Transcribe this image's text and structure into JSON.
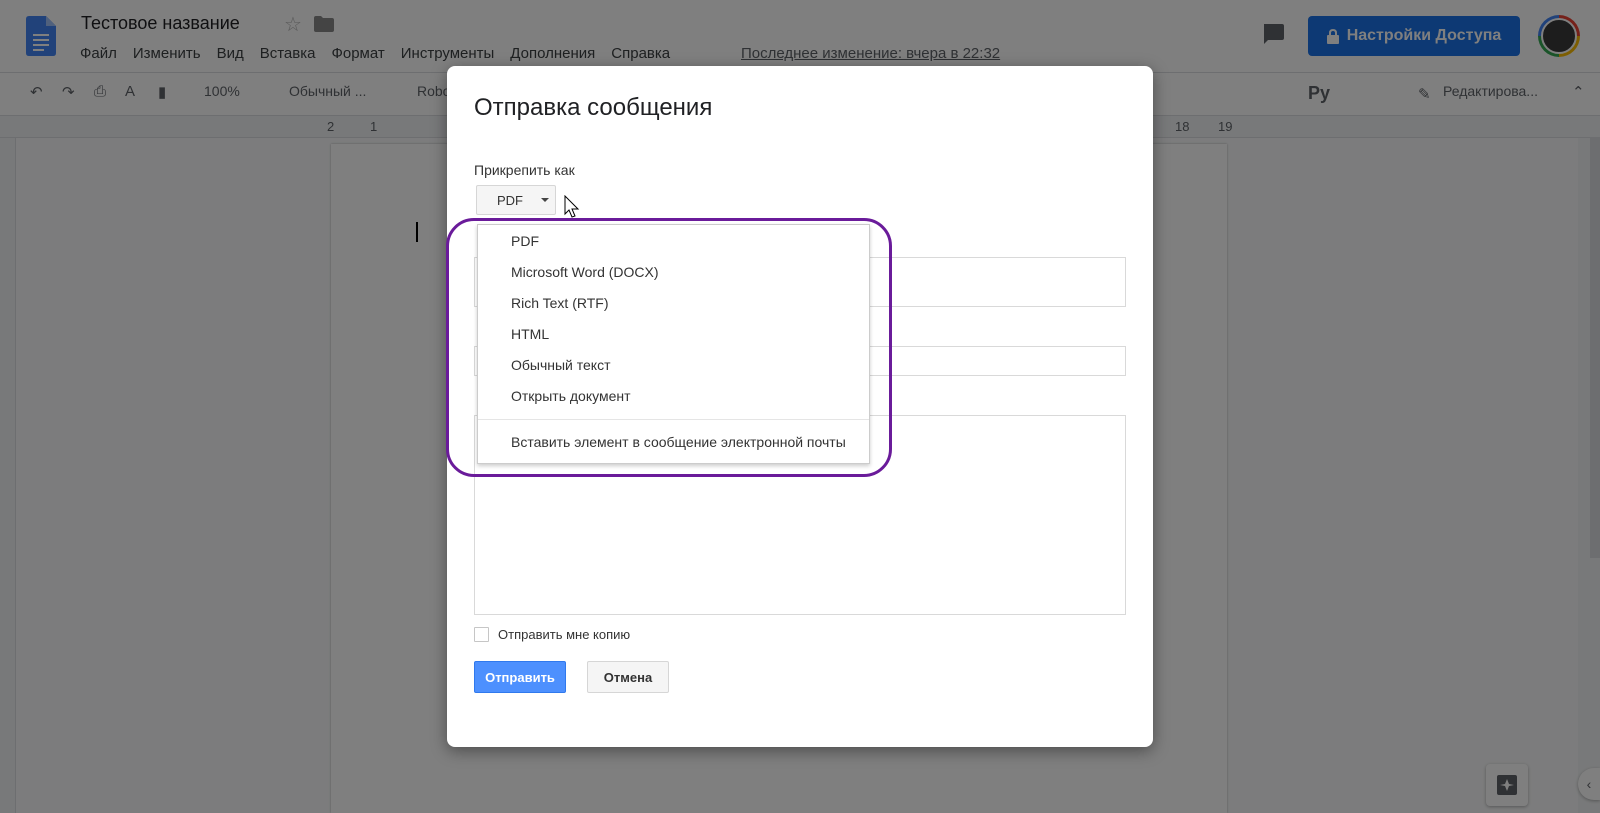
{
  "header": {
    "doc_title": "Тестовое название",
    "menu": [
      "Файл",
      "Изменить",
      "Вид",
      "Вставка",
      "Формат",
      "Инструменты",
      "Дополнения",
      "Справка"
    ],
    "last_edit": "Последнее изменение: вчера в 22:32",
    "share_label": "Настройки Доступа"
  },
  "toolbar": {
    "zoom": "100%",
    "style": "Обычный ...",
    "font": "Robo",
    "lang": "Ру",
    "mode": "Редактирова..."
  },
  "ruler": {
    "left_nums": [
      "2",
      "1"
    ],
    "right_nums": [
      "18",
      "19"
    ]
  },
  "dialog": {
    "title": "Отправка сообщения",
    "attach_label": "Прикрепить как",
    "format_value": "PDF",
    "copy_label": "Отправить мне копию",
    "send_label": "Отправить",
    "cancel_label": "Отмена"
  },
  "dropdown": {
    "options": [
      "PDF",
      "Microsoft Word (DOCX)",
      "Rich Text (RTF)",
      "HTML",
      "Обычный текст",
      "Открыть документ"
    ],
    "extra_option": "Вставить элемент в сообщение электронной почты"
  },
  "colors": {
    "share_button": "#1a73e8",
    "send_button": "#4d90fe",
    "highlight_ring": "#6a1b9a",
    "docs_logo": "#4285f4"
  }
}
